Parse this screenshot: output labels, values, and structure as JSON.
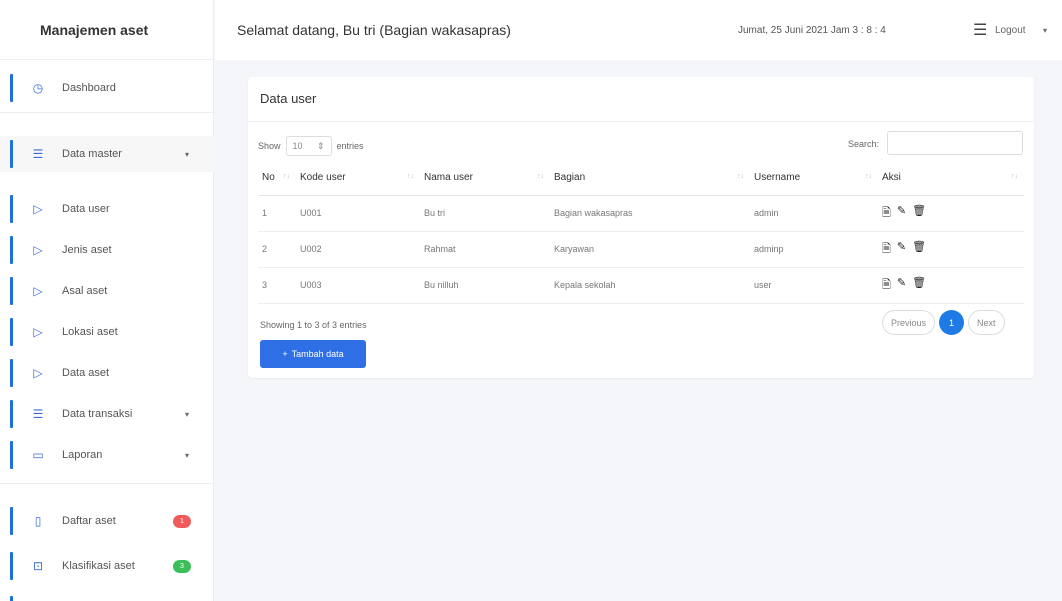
{
  "sidebar": {
    "brand": "Manajemen aset",
    "items": [
      {
        "label": "Dashboard",
        "icon": "clock-icon"
      },
      {
        "label": "Data master",
        "icon": "list-icon"
      },
      {
        "label": "Data user",
        "icon": "play-icon"
      },
      {
        "label": "Jenis aset",
        "icon": "play-icon"
      },
      {
        "label": "Asal aset",
        "icon": "play-icon"
      },
      {
        "label": "Lokasi aset",
        "icon": "play-icon"
      },
      {
        "label": "Data aset",
        "icon": "play-icon"
      },
      {
        "label": "Data transaksi",
        "icon": "list-icon"
      },
      {
        "label": "Laporan",
        "icon": "file-icon"
      },
      {
        "label": "Daftar aset",
        "icon": "document-icon",
        "badge": "1",
        "badge_color": "#f05a5a"
      },
      {
        "label": "Klasifikasi aset",
        "icon": "layout-icon",
        "badge": "3",
        "badge_color": "#3cbf58"
      }
    ]
  },
  "header": {
    "welcome": "Selamat datang, Bu tri (Bagian wakasapras)",
    "datetime": "Jumat, 25 Juni 2021  Jam 3 : 8 : 4",
    "logout": "Logout"
  },
  "card": {
    "title": "Data user",
    "show_label": "Show",
    "entries_value": "10",
    "entries_label": "entries",
    "search_label": "Search:",
    "search_value": "",
    "columns": [
      "No",
      "Kode user",
      "Nama user",
      "Bagian",
      "Username",
      "Aksi"
    ],
    "rows": [
      [
        "1",
        "U001",
        "Bu tri",
        "Bagian wakasapras",
        "admin"
      ],
      [
        "2",
        "U002",
        "Rahmat",
        "Karyawan",
        "adminp"
      ],
      [
        "3",
        "U003",
        "Bu nilluh",
        "Kepala sekolah",
        "user"
      ]
    ],
    "showing": "Showing 1 to 3 of 3 entries",
    "prev": "Previous",
    "page": "1",
    "next": "Next",
    "add_button": "Tambah data"
  },
  "colors": {
    "accent": "#2f6fe6",
    "badge_red": "#f05a5a",
    "badge_green": "#3cbf58"
  }
}
